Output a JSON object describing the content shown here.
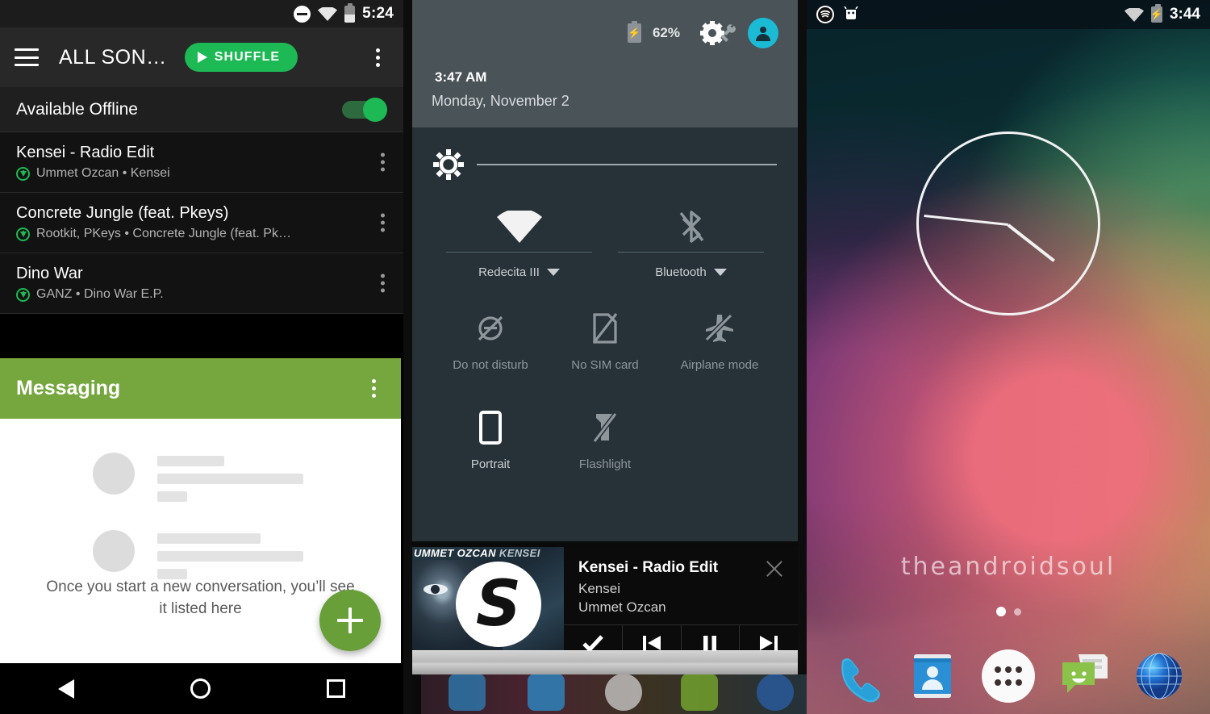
{
  "spotify": {
    "status_bar": {
      "time": "5:24",
      "icons": [
        "do-not-disturb-icon",
        "wifi-icon",
        "battery-icon"
      ]
    },
    "app_bar": {
      "menu_icon": "hamburger-icon",
      "title": "ALL SON…",
      "shuffle_label": "SHUFFLE",
      "overflow_icon": "kebab-menu-icon"
    },
    "offline_row": {
      "label": "Available Offline",
      "toggle_state": "on",
      "accent": "#1DB954"
    },
    "songs": [
      {
        "title": "Kensei - Radio Edit",
        "artist_album": "Ummet Ozcan • Kensei",
        "downloaded": true
      },
      {
        "title": "Concrete Jungle (feat. Pkeys)",
        "artist_album": "Rootkit, PKeys • Concrete Jungle (feat. Pk…",
        "downloaded": true
      },
      {
        "title": "Dino War",
        "artist_album": "GANZ • Dino War E.P.",
        "downloaded": true
      }
    ]
  },
  "messaging": {
    "title": "Messaging",
    "header_color": "#76A73E",
    "overflow_icon": "kebab-menu-icon",
    "empty_state": "Once you start a new conversation, you’ll see it listed here",
    "fab": {
      "icon": "plus-icon",
      "color": "#689F38"
    }
  },
  "nav_bar": {
    "back": "back-triangle-icon",
    "home": "home-circle-icon",
    "recents": "recents-square-icon"
  },
  "quick_settings": {
    "header": {
      "battery_percent": "62%",
      "battery_icon": "battery-charging-icon",
      "settings_icon": "gear-wrench-icon",
      "avatar_icon": "user-avatar-icon",
      "time": "3:47",
      "meridiem": "AM",
      "date": "Monday, November 2"
    },
    "brightness": {
      "icon": "brightness-icon",
      "value": 0
    },
    "big_tiles": [
      {
        "label": "Redecita III",
        "icon": "wifi-icon",
        "state": "on"
      },
      {
        "label": "Bluetooth",
        "icon": "bluetooth-off-icon",
        "state": "off"
      }
    ],
    "tiles": [
      {
        "label": "Do not disturb",
        "icon": "do-not-disturb-off-icon",
        "state": "off"
      },
      {
        "label": "No SIM card",
        "icon": "no-sim-icon",
        "state": "off"
      },
      {
        "label": "Airplane mode",
        "icon": "airplane-off-icon",
        "state": "off"
      },
      {
        "label": "Portrait",
        "icon": "portrait-icon",
        "state": "on"
      },
      {
        "label": "Flashlight",
        "icon": "flashlight-off-icon",
        "state": "off"
      }
    ],
    "media_notification": {
      "album_caption_primary": "UMMET OZCAN",
      "album_caption_secondary": "KENSEI",
      "album_logo": "spinnin-records-logo",
      "title": "Kensei - Radio Edit",
      "line2": "Kensei",
      "line3": "Ummet Ozcan",
      "close_icon": "close-icon",
      "controls": [
        "check-icon",
        "previous-track-icon",
        "pause-icon",
        "next-track-icon"
      ]
    }
  },
  "home_screen": {
    "status_bar": {
      "left_icons": [
        "spotify-icon",
        "android-robot-icon"
      ],
      "right_icons": [
        "wifi-icon",
        "battery-charging-icon"
      ],
      "time": "3:44"
    },
    "clock_widget": {
      "icon": "analog-clock-widget",
      "hour_angle": 38,
      "minute_angle": 186
    },
    "watermark": "theandroidsoul",
    "page_dots": {
      "count": 2,
      "active_index": 0
    },
    "dock": [
      {
        "name": "phone-icon",
        "label": "Phone"
      },
      {
        "name": "contacts-icon",
        "label": "Contacts"
      },
      {
        "name": "app-drawer-icon",
        "label": "Apps"
      },
      {
        "name": "messaging-icon",
        "label": "Messaging"
      },
      {
        "name": "browser-icon",
        "label": "Browser"
      }
    ]
  }
}
